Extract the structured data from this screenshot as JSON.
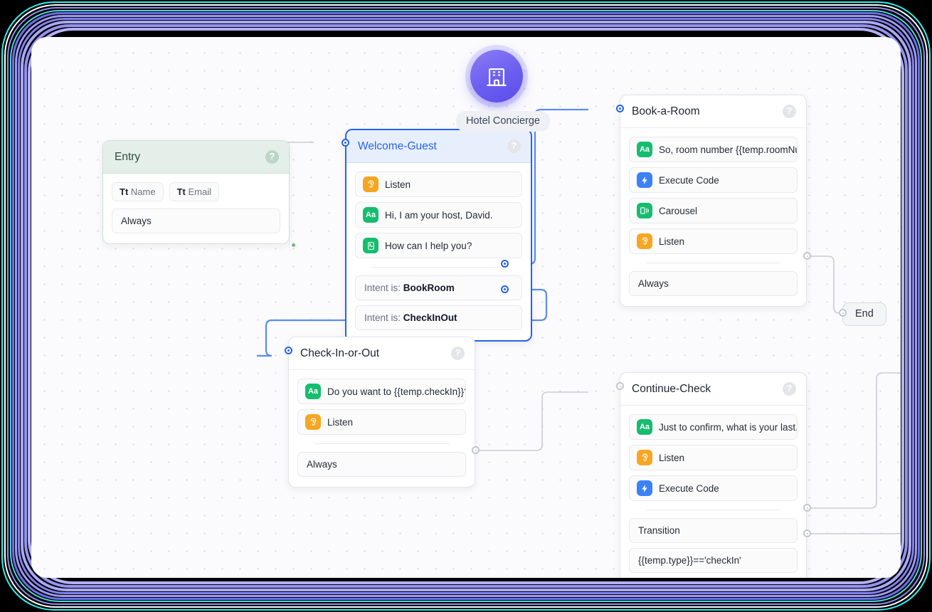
{
  "agent": {
    "name": "Hotel Concierge",
    "icon": "hotel-building-icon"
  },
  "canvas": {
    "end_node_label": "End"
  },
  "nodes": [
    {
      "id": "entry",
      "title": "Entry",
      "help_icon": "help-icon",
      "variables": [
        {
          "prefix": "Tt",
          "label": "Name"
        },
        {
          "prefix": "Tt",
          "label": "Email"
        }
      ],
      "transitions": [
        {
          "label": "Always"
        }
      ]
    },
    {
      "id": "welcome",
      "title": "Welcome-Guest",
      "help_icon": "help-icon",
      "selected": true,
      "steps": [
        {
          "icon": "listen-ear-icon",
          "icon_color": "#f5a623",
          "glyph": "ear",
          "label": "Listen"
        },
        {
          "icon": "text-message-icon",
          "icon_color": "#16bd6e",
          "glyph": "Aa",
          "label": "Hi, I am your host, David."
        },
        {
          "icon": "card-message-icon",
          "icon_color": "#16bd6e",
          "glyph": "card",
          "label": "How can I help you?"
        }
      ],
      "transitions": [
        {
          "prefix": "Intent is:",
          "value": "BookRoom"
        },
        {
          "prefix": "Intent is:",
          "value": "CheckInOut"
        }
      ]
    },
    {
      "id": "book",
      "title": "Book-a-Room",
      "help_icon": "help-icon",
      "steps": [
        {
          "icon": "text-message-icon",
          "icon_color": "#16bd6e",
          "glyph": "Aa",
          "label": "So, room number {{temp.roomNu..."
        },
        {
          "icon": "execute-code-icon",
          "icon_color": "#3b82f6",
          "glyph": "bolt",
          "label": "Execute Code"
        },
        {
          "icon": "carousel-icon",
          "icon_color": "#16bd6e",
          "glyph": "carousel",
          "label": "Carousel"
        },
        {
          "icon": "listen-ear-icon",
          "icon_color": "#f5a623",
          "glyph": "ear",
          "label": "Listen"
        }
      ],
      "transitions": [
        {
          "label": "Always"
        }
      ]
    },
    {
      "id": "checkin",
      "title": "Check-In-or-Out",
      "help_icon": "help-icon",
      "steps": [
        {
          "icon": "text-message-icon",
          "icon_color": "#16bd6e",
          "glyph": "Aa",
          "label": "Do you want to {{temp.checkIn}}?"
        },
        {
          "icon": "listen-ear-icon",
          "icon_color": "#f5a623",
          "glyph": "ear",
          "label": "Listen"
        }
      ],
      "transitions": [
        {
          "label": "Always"
        }
      ]
    },
    {
      "id": "continue",
      "title": "Continue-Check",
      "help_icon": "help-icon",
      "steps": [
        {
          "icon": "text-message-icon",
          "icon_color": "#16bd6e",
          "glyph": "Aa",
          "label": "Just to confirm, what is your last..."
        },
        {
          "icon": "listen-ear-icon",
          "icon_color": "#f5a623",
          "glyph": "ear",
          "label": "Listen"
        },
        {
          "icon": "execute-code-icon",
          "icon_color": "#3b82f6",
          "glyph": "bolt",
          "label": "Execute Code"
        }
      ],
      "transitions": [
        {
          "label": "Transition"
        },
        {
          "label": "{{temp.type}}=='checkIn'"
        }
      ]
    }
  ],
  "colors": {
    "selected_edge": "#5b8def",
    "edge": "#c9ccd3",
    "accent_purple": "#6b5ef0",
    "entry_green": "#e4efe9"
  }
}
